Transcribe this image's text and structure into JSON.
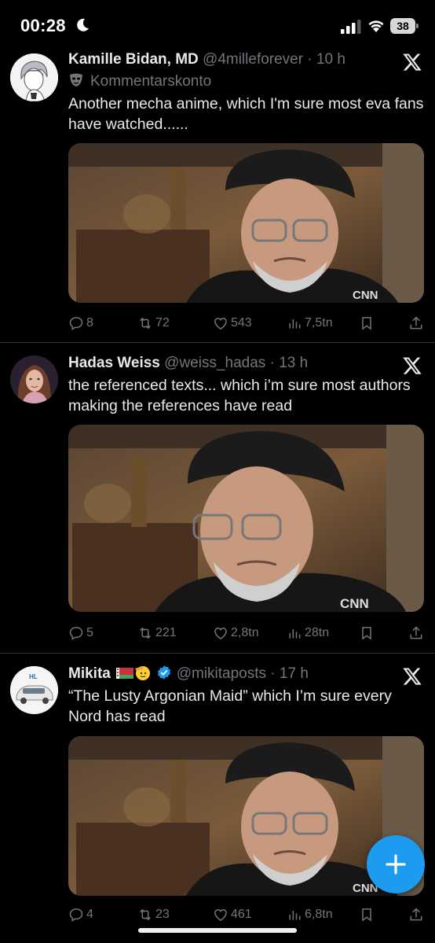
{
  "status_bar": {
    "time": "00:28",
    "battery": "38"
  },
  "tweets": [
    {
      "name": "Kamille Bidan, MD",
      "handle": "@4milleforever",
      "time": "10 h",
      "subline": "Kommentarskonto",
      "text": "Another mecha anime, which I'm sure most eva fans have watched......",
      "image_label": "CNN",
      "replies": "8",
      "reposts": "72",
      "likes": "543",
      "views": "7,5tn"
    },
    {
      "name": "Hadas Weiss",
      "handle": "@weiss_hadas",
      "time": "13 h",
      "text": "the referenced texts... which i’m sure most authors making the references have read",
      "image_label": "CNN",
      "replies": "5",
      "reposts": "221",
      "likes": "2,8tn",
      "views": "28tn"
    },
    {
      "name": "Mikita",
      "emoji": "🇧🇾🫡",
      "handle": "@mikitaposts",
      "time": "17 h",
      "text": "“The Lusty Argonian Maid” which I’m sure every Nord has read",
      "image_label": "CNN",
      "avatar_text": "HL",
      "replies": "4",
      "reposts": "23",
      "likes": "461",
      "views": "6,8tn"
    }
  ],
  "colors": {
    "accent": "#1d9bf0",
    "muted": "#71767b",
    "text": "#e7e9ea",
    "verified": "#1d9bf0"
  },
  "icons": [
    "reply-icon",
    "repost-icon",
    "like-icon",
    "views-icon",
    "bookmark-icon",
    "share-icon",
    "x-logo-icon",
    "compose-plus-icon"
  ]
}
